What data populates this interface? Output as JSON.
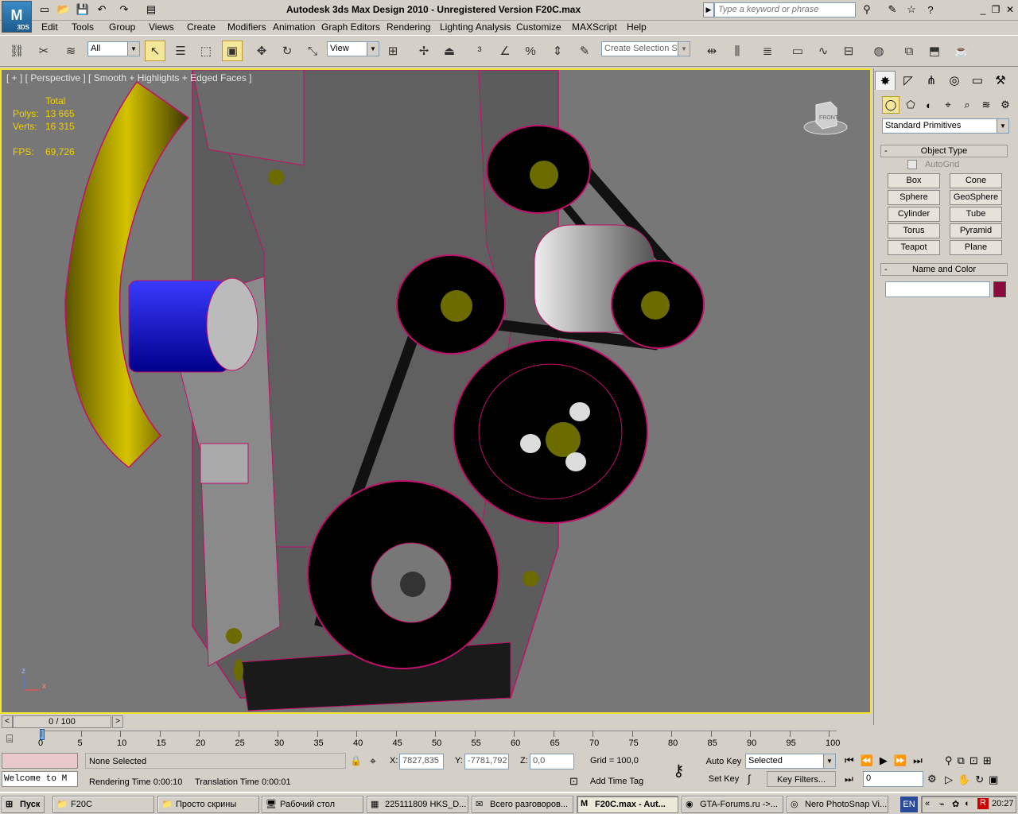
{
  "app": {
    "logo_text": "3DS",
    "title": "Autodesk 3ds Max Design 2010  - Unregistered Version    F20C.max"
  },
  "search": {
    "placeholder": "Type a keyword or phrase"
  },
  "menu": [
    "Edit",
    "Tools",
    "Group",
    "Views",
    "Create",
    "Modifiers",
    "Animation",
    "Graph Editors",
    "Rendering",
    "Lighting Analysis",
    "Customize",
    "MAXScript",
    "Help"
  ],
  "toolbar": {
    "filter_value": "All",
    "ref_coord_value": "View",
    "named_selection_placeholder": "Create Selection Se"
  },
  "viewport": {
    "label": "[ + ] [ Perspective ] [ Smooth + Highlights + Edged Faces ]",
    "stats": {
      "header": "Total",
      "polys_label": "Polys:",
      "polys_value": "13 665",
      "verts_label": "Verts:",
      "verts_value": "16 315",
      "fps_label": "FPS:",
      "fps_value": "69,726"
    },
    "viewcube_label": "FRONT",
    "axis": {
      "z": "z",
      "x": "x"
    }
  },
  "command_panel": {
    "category_value": "Standard Primitives",
    "object_type_title": "Object Type",
    "autogrid_label": "AutoGrid",
    "buttons": [
      "Box",
      "Cone",
      "Sphere",
      "GeoSphere",
      "Cylinder",
      "Tube",
      "Torus",
      "Pyramid",
      "Teapot",
      "Plane"
    ],
    "name_color_title": "Name and Color",
    "object_color": "#8b0a3c"
  },
  "timeline": {
    "frame_display": "0 / 100",
    "ticks": [
      "0",
      "5",
      "10",
      "15",
      "20",
      "25",
      "30",
      "35",
      "40",
      "45",
      "50",
      "55",
      "60",
      "65",
      "70",
      "75",
      "80",
      "85",
      "90",
      "95",
      "100"
    ]
  },
  "status": {
    "listener": "Welcome to M",
    "selection": "None Selected",
    "rendering_time": "Rendering Time  0:00:10",
    "translation_time": "Translation Time  0:00:01",
    "x_label": "X:",
    "x_value": "7827,835",
    "y_label": "Y:",
    "y_value": "-7781,792",
    "z_label": "Z:",
    "z_value": "0,0",
    "grid": "Grid = 100,0",
    "add_time_tag": "Add Time Tag",
    "auto_key": "Auto Key",
    "set_key": "Set Key",
    "key_mode_value": "Selected",
    "key_filters": "Key Filters...",
    "current_frame": "0"
  },
  "taskbar": {
    "start": "Пуск",
    "tasks": [
      "F20C",
      "Просто скрины",
      "Рабочий стол",
      "225111809 HKS_D...",
      "Всего разговоров...",
      "F20C.max - Aut...",
      "GTA-Forums.ru ->...",
      "Nero PhotoSnap Vi..."
    ],
    "lang": "EN",
    "clock": "20:27"
  }
}
